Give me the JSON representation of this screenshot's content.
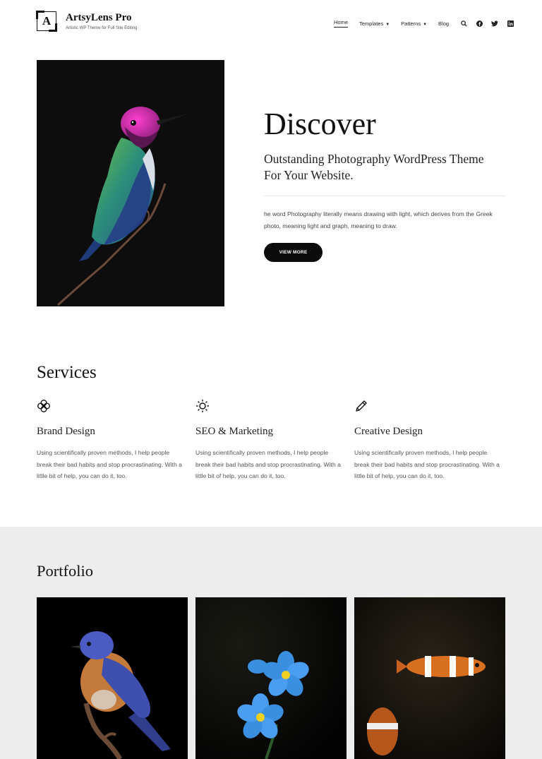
{
  "site": {
    "title": "ArtsyLens Pro",
    "tagline": "Artistic WP Theme for Full Site Editing",
    "logo_letter": "A"
  },
  "nav": {
    "items": [
      {
        "label": "Home",
        "active": true
      },
      {
        "label": "Templates",
        "dropdown": true
      },
      {
        "label": "Patterns",
        "dropdown": true
      },
      {
        "label": "Blog"
      }
    ],
    "icons": [
      "search-icon",
      "facebook-icon",
      "twitter-icon",
      "linkedin-icon"
    ]
  },
  "hero": {
    "title": "Discover",
    "subtitle": "Outstanding Photography WordPress Theme For Your Website.",
    "description": "he word Photography literally means drawing with light, which derives from the Greek photo, meaning light and graph, meaning to draw.",
    "button": "VIEW MORE"
  },
  "services": {
    "title": "Services",
    "items": [
      {
        "icon": "flower-icon",
        "name": "Brand Design",
        "desc": "Using scientifically proven methods, I help people break their bad habits and stop procrastinating. With a little bit of help, you can do it, too."
      },
      {
        "icon": "sun-icon",
        "name": "SEO & Marketing",
        "desc": "Using scientifically proven methods, I help people break their bad habits and stop procrastinating. With a little bit of help, you can do it, too."
      },
      {
        "icon": "pencil-icon",
        "name": "Creative Design",
        "desc": "Using scientifically proven methods, I help people break their bad habits and stop procrastinating. With a little bit of help, you can do it, too."
      }
    ]
  },
  "portfolio": {
    "title": "Portfolio",
    "items": [
      "bluebird-photo",
      "forget-me-not-photo",
      "clownfish-photo"
    ]
  },
  "colors": {
    "accent": "#0b0b0b",
    "portfolio_bg": "#ededed"
  }
}
